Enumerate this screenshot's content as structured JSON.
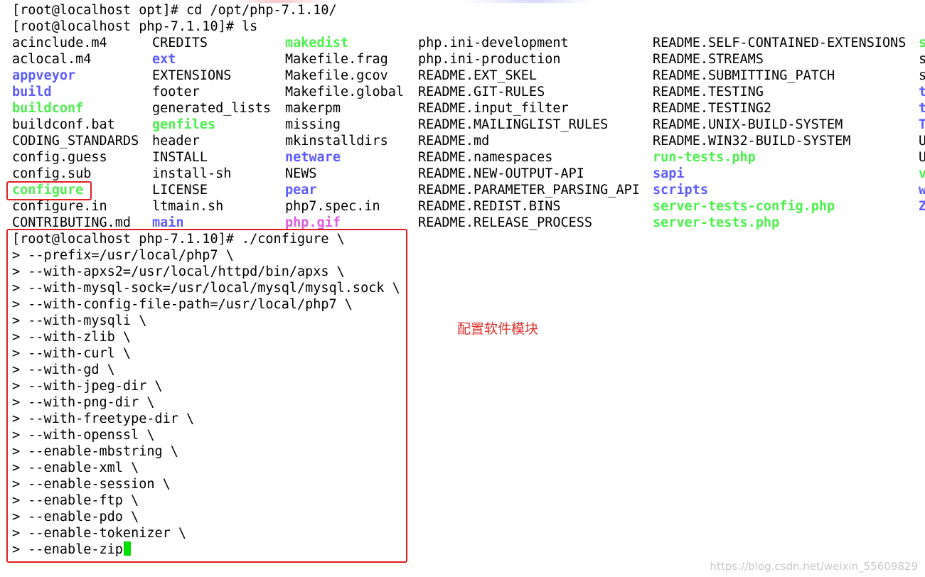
{
  "terminal": {
    "prompt_cd": "[root@localhost opt]# cd /opt/php-7.1.10/",
    "prompt_ls": "[root@localhost php-7.1.10]# ls",
    "ls_columns": [
      [
        {
          "name": "acinclude.m4",
          "type": "file"
        },
        {
          "name": "aclocal.m4",
          "type": "file"
        },
        {
          "name": "appveyor",
          "type": "dir"
        },
        {
          "name": "build",
          "type": "dir"
        },
        {
          "name": "buildconf",
          "type": "exec"
        },
        {
          "name": "buildconf.bat",
          "type": "file"
        },
        {
          "name": "CODING_STANDARDS",
          "type": "file"
        },
        {
          "name": "config.guess",
          "type": "file"
        },
        {
          "name": "config.sub",
          "type": "file"
        },
        {
          "name": "configure",
          "type": "exec"
        },
        {
          "name": "configure.in",
          "type": "file"
        },
        {
          "name": "CONTRIBUTING.md",
          "type": "file"
        }
      ],
      [
        {
          "name": "CREDITS",
          "type": "file"
        },
        {
          "name": "ext",
          "type": "dir"
        },
        {
          "name": "EXTENSIONS",
          "type": "file"
        },
        {
          "name": "footer",
          "type": "file"
        },
        {
          "name": "generated_lists",
          "type": "file"
        },
        {
          "name": "genfiles",
          "type": "exec"
        },
        {
          "name": "header",
          "type": "file"
        },
        {
          "name": "INSTALL",
          "type": "file"
        },
        {
          "name": "install-sh",
          "type": "file"
        },
        {
          "name": "LICENSE",
          "type": "file"
        },
        {
          "name": "ltmain.sh",
          "type": "file"
        },
        {
          "name": "main",
          "type": "dir"
        }
      ],
      [
        {
          "name": "makedist",
          "type": "exec"
        },
        {
          "name": "Makefile.frag",
          "type": "file"
        },
        {
          "name": "Makefile.gcov",
          "type": "file"
        },
        {
          "name": "Makefile.global",
          "type": "file"
        },
        {
          "name": "makerpm",
          "type": "file"
        },
        {
          "name": "missing",
          "type": "file"
        },
        {
          "name": "mkinstalldirs",
          "type": "file"
        },
        {
          "name": "netware",
          "type": "dir"
        },
        {
          "name": "NEWS",
          "type": "file"
        },
        {
          "name": "pear",
          "type": "dir"
        },
        {
          "name": "php7.spec.in",
          "type": "file"
        },
        {
          "name": "php.gif",
          "type": "img"
        }
      ],
      [
        {
          "name": "php.ini-development",
          "type": "file"
        },
        {
          "name": "php.ini-production",
          "type": "file"
        },
        {
          "name": "README.EXT_SKEL",
          "type": "file"
        },
        {
          "name": "README.GIT-RULES",
          "type": "file"
        },
        {
          "name": "README.input_filter",
          "type": "file"
        },
        {
          "name": "README.MAILINGLIST_RULES",
          "type": "file"
        },
        {
          "name": "README.md",
          "type": "file"
        },
        {
          "name": "README.namespaces",
          "type": "file"
        },
        {
          "name": "README.NEW-OUTPUT-API",
          "type": "file"
        },
        {
          "name": "README.PARAMETER_PARSING_API",
          "type": "file"
        },
        {
          "name": "README.REDIST.BINS",
          "type": "file"
        },
        {
          "name": "README.RELEASE_PROCESS",
          "type": "file"
        }
      ],
      [
        {
          "name": "README.SELF-CONTAINED-EXTENSIONS",
          "type": "file"
        },
        {
          "name": "README.STREAMS",
          "type": "file"
        },
        {
          "name": "README.SUBMITTING_PATCH",
          "type": "file"
        },
        {
          "name": "README.TESTING",
          "type": "file"
        },
        {
          "name": "README.TESTING2",
          "type": "file"
        },
        {
          "name": "README.UNIX-BUILD-SYSTEM",
          "type": "file"
        },
        {
          "name": "README.WIN32-BUILD-SYSTEM",
          "type": "file"
        },
        {
          "name": "run-tests.php",
          "type": "exec"
        },
        {
          "name": "sapi",
          "type": "dir"
        },
        {
          "name": "scripts",
          "type": "dir"
        },
        {
          "name": "server-tests-config.php",
          "type": "exec"
        },
        {
          "name": "server-tests.php",
          "type": "exec"
        }
      ],
      [
        {
          "name": "s",
          "type": "exec"
        },
        {
          "name": "s",
          "type": "file"
        },
        {
          "name": "s",
          "type": "file"
        },
        {
          "name": "t",
          "type": "dir"
        },
        {
          "name": "t",
          "type": "dir"
        },
        {
          "name": "T",
          "type": "dir"
        },
        {
          "name": "U",
          "type": "file"
        },
        {
          "name": "U",
          "type": "file"
        },
        {
          "name": "v",
          "type": "exec"
        },
        {
          "name": "w",
          "type": "dir"
        },
        {
          "name": "Z",
          "type": "dir"
        },
        {
          "name": "",
          "type": "file"
        }
      ]
    ],
    "configure_lines": [
      "[root@localhost php-7.1.10]# ./configure \\",
      "> --prefix=/usr/local/php7 \\",
      "> --with-apxs2=/usr/local/httpd/bin/apxs \\",
      "> --with-mysql-sock=/usr/local/mysql/mysql.sock \\",
      "> --with-config-file-path=/usr/local/php7 \\",
      "> --with-mysqli \\",
      "> --with-zlib \\",
      "> --with-curl \\",
      "> --with-gd \\",
      "> --with-jpeg-dir \\",
      "> --with-png-dir \\",
      "> --with-freetype-dir \\",
      "> --with-openssl \\",
      "> --enable-mbstring \\",
      "> --enable-xml \\",
      "> --enable-session \\",
      "> --enable-ftp \\",
      "> --enable-pdo \\",
      "> --enable-tokenizer \\",
      "> --enable-zip"
    ],
    "cursor_icon": "block-cursor-icon"
  },
  "annotation": {
    "label": "配置软件模块",
    "color": "#e02020"
  },
  "watermark": "https://blog.csdn.net/weixin_55609829",
  "colors": {
    "directory": "#5c5cff",
    "executable": "#4cf04c",
    "image": "#e05ce0",
    "text": "#000000",
    "cursor": "#00e000"
  }
}
